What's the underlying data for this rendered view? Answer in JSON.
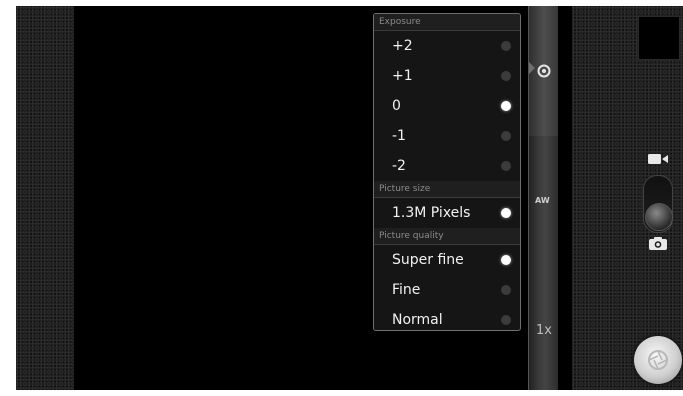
{
  "settings_menu": {
    "sections": [
      {
        "title": "Exposure",
        "options": [
          {
            "label": "+2",
            "selected": false
          },
          {
            "label": "+1",
            "selected": false
          },
          {
            "label": "0",
            "selected": true
          },
          {
            "label": "-1",
            "selected": false
          },
          {
            "label": "-2",
            "selected": false
          }
        ]
      },
      {
        "title": "Picture size",
        "options": [
          {
            "label": "1.3M Pixels",
            "selected": true
          }
        ]
      },
      {
        "title": "Picture quality",
        "options": [
          {
            "label": "Super fine",
            "selected": true
          },
          {
            "label": "Fine",
            "selected": false
          },
          {
            "label": "Normal",
            "selected": false
          }
        ]
      }
    ]
  },
  "side_strip": {
    "settings_icon": "gear-icon",
    "white_balance_label": "AW",
    "zoom_label": "1x"
  },
  "controls": {
    "mode_video_icon": "video-camera-icon",
    "mode_photo_icon": "camera-icon",
    "shutter_icon": "aperture-icon",
    "mode": "photo"
  },
  "colors": {
    "selected_radio": "#ffffff",
    "unselected_radio": "#3b3b3b",
    "menu_border": "#6f6f6f"
  }
}
